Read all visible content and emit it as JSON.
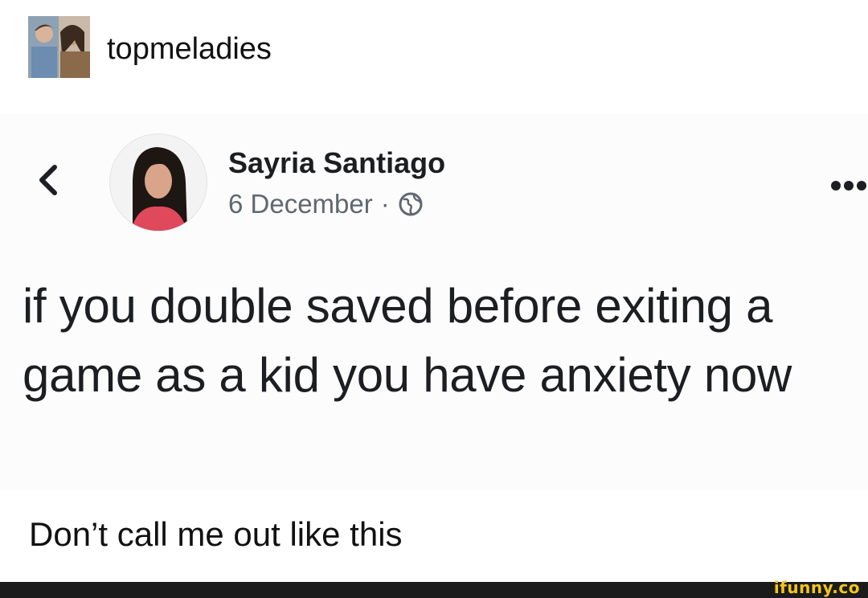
{
  "tumblr_post": {
    "blog_name": "topmeladies",
    "avatar_icon": "blog-avatar-photo"
  },
  "facebook_post": {
    "back_icon": "chevron-left-icon",
    "author": "Sayria Santiago",
    "date": "6 December",
    "separator": "·",
    "privacy_icon": "globe-icon",
    "more_icon": "more-dots-icon",
    "text": "if you double saved before exiting a game as a kid you have anxiety now"
  },
  "caption": "Don’t call me out like this",
  "watermark": {
    "text": "ifunny.co",
    "color": "#f5c518"
  }
}
